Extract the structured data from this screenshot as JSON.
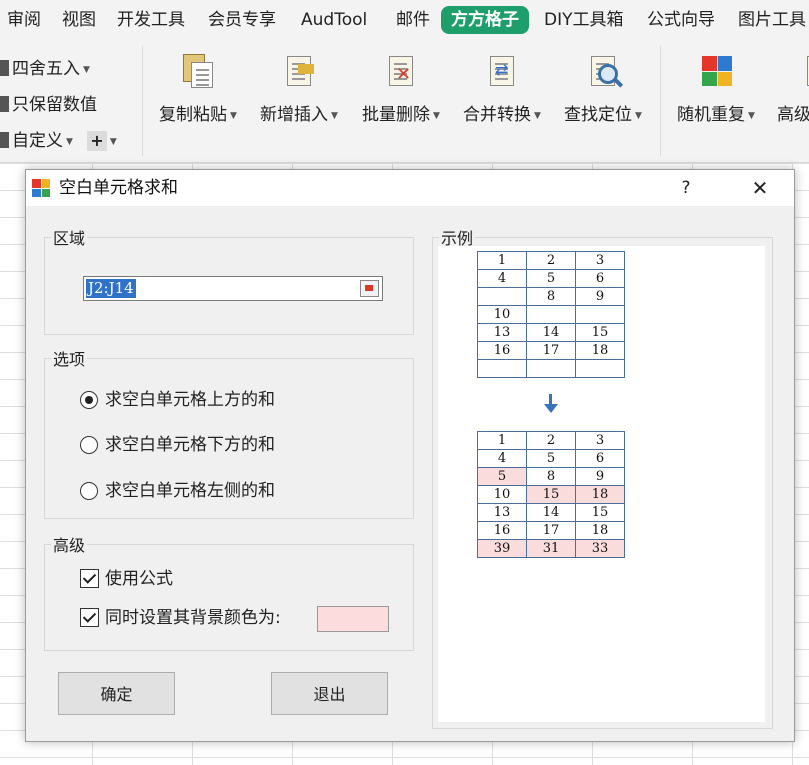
{
  "menubar": {
    "items": [
      {
        "label": "审阅",
        "active": false
      },
      {
        "label": "视图",
        "active": false
      },
      {
        "label": "开发工具",
        "active": false
      },
      {
        "label": "会员专享",
        "active": false
      },
      {
        "label": "AudTool",
        "active": false
      },
      {
        "label": "邮件",
        "active": false
      },
      {
        "label": "方方格子",
        "active": true
      },
      {
        "label": "DIY工具箱",
        "active": false
      },
      {
        "label": "公式向导",
        "active": false
      },
      {
        "label": "图片工具",
        "active": false
      }
    ],
    "accent_color": "#1e9e6a"
  },
  "ribbon": {
    "small_items": [
      {
        "label": "四舍五入",
        "has_dropdown": true
      },
      {
        "label": "只保留数值",
        "has_dropdown": false
      },
      {
        "label": "自定义",
        "has_dropdown": true
      }
    ],
    "plus_label": "+",
    "big_buttons": [
      {
        "label": "复制粘贴",
        "icon": "paste-icon"
      },
      {
        "label": "新增插入",
        "icon": "insert-icon"
      },
      {
        "label": "批量删除",
        "icon": "delete-icon"
      },
      {
        "label": "合并转换",
        "icon": "convert-icon"
      },
      {
        "label": "查找定位",
        "icon": "find-icon"
      },
      {
        "label": "随机重复",
        "icon": "random-icon"
      },
      {
        "label": "高级",
        "icon": "advanced-icon"
      }
    ]
  },
  "dialog": {
    "title": "空白单元格求和",
    "help_label": "?",
    "close_label": "✕",
    "region": {
      "legend": "区域",
      "value": "J2:J14"
    },
    "options": {
      "legend": "选项",
      "choices": [
        {
          "label": "求空白单元格上方的和",
          "selected": true
        },
        {
          "label": "求空白单元格下方的和",
          "selected": false
        },
        {
          "label": "求空白单元格左侧的和",
          "selected": false
        }
      ]
    },
    "advanced": {
      "legend": "高级",
      "use_formula": {
        "label": "使用公式",
        "checked": true
      },
      "set_background": {
        "label": "同时设置其背景颜色为:",
        "checked": true
      },
      "background_color": "#fcdcdc"
    },
    "ok_label": "确定",
    "cancel_label": "退出",
    "example": {
      "legend": "示例",
      "before": [
        [
          "1",
          "2",
          "3"
        ],
        [
          "4",
          "5",
          "6"
        ],
        [
          "",
          "8",
          "9"
        ],
        [
          "10",
          "",
          ""
        ],
        [
          "13",
          "14",
          "15"
        ],
        [
          "16",
          "17",
          "18"
        ],
        [
          "",
          "",
          ""
        ]
      ],
      "after": [
        [
          "1",
          "2",
          "3"
        ],
        [
          "4",
          "5",
          "6"
        ],
        [
          "5",
          "8",
          "9"
        ],
        [
          "10",
          "15",
          "18"
        ],
        [
          "13",
          "14",
          "15"
        ],
        [
          "16",
          "17",
          "18"
        ],
        [
          "39",
          "31",
          "33"
        ]
      ],
      "highlighted_cells": [
        [
          2,
          0
        ],
        [
          3,
          1
        ],
        [
          3,
          2
        ],
        [
          6,
          0
        ],
        [
          6,
          1
        ],
        [
          6,
          2
        ]
      ],
      "highlight_color": "#fadcdc"
    }
  }
}
